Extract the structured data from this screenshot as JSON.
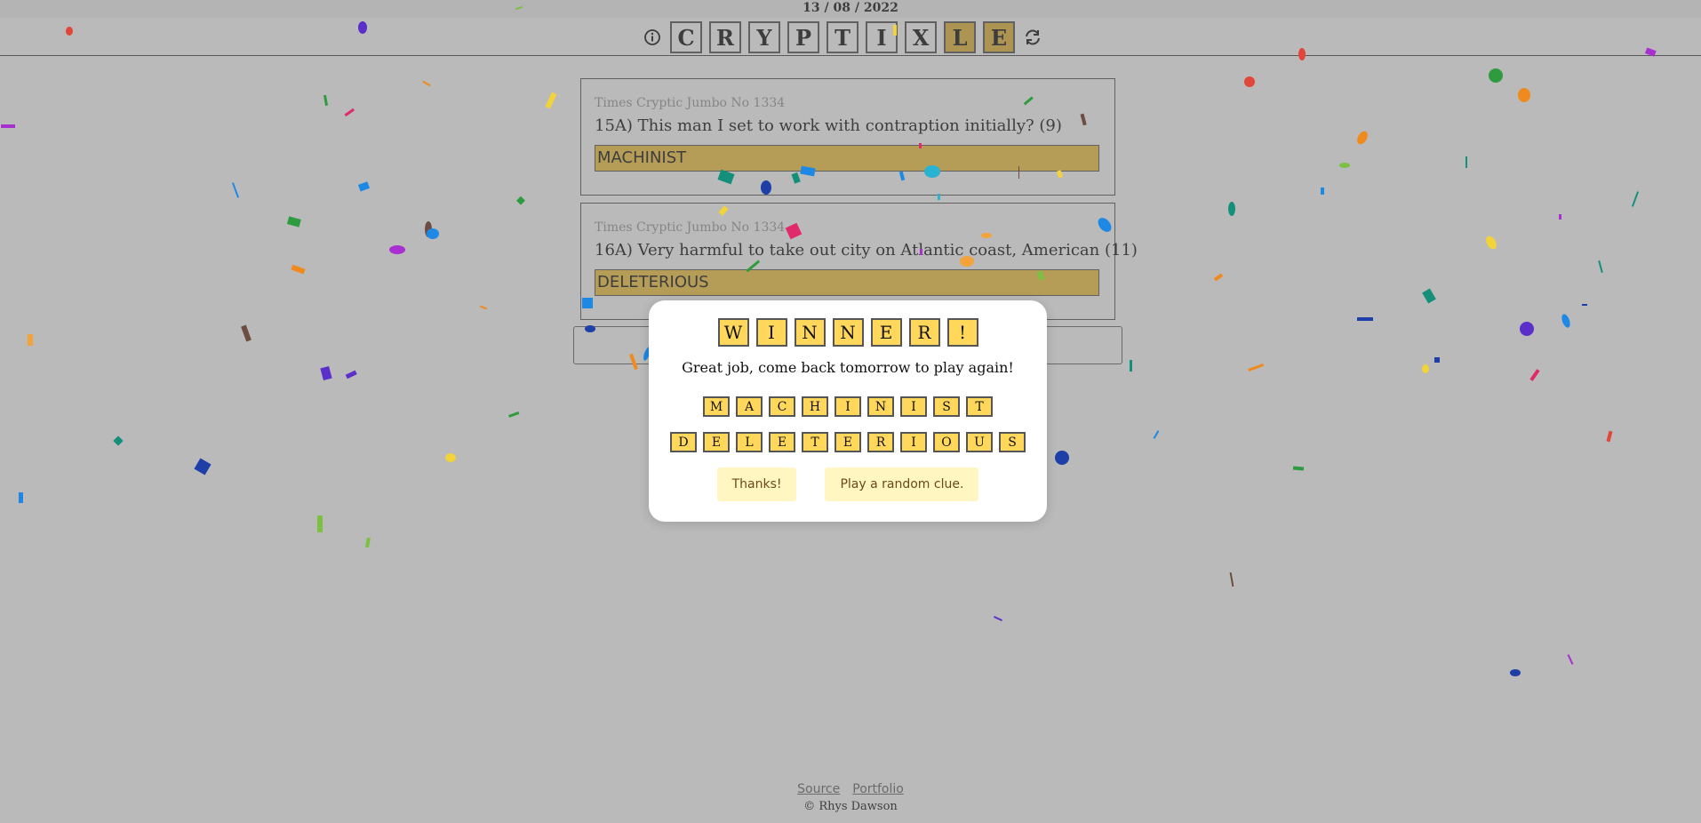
{
  "header": {
    "date": "13 / 08 / 2022",
    "title_letters": [
      {
        "char": "C",
        "highlight": false
      },
      {
        "char": "R",
        "highlight": false
      },
      {
        "char": "Y",
        "highlight": false
      },
      {
        "char": "P",
        "highlight": false
      },
      {
        "char": "T",
        "highlight": false
      },
      {
        "char": "I",
        "highlight": false
      },
      {
        "char": "X",
        "highlight": false
      },
      {
        "char": "L",
        "highlight": true
      },
      {
        "char": "E",
        "highlight": true
      }
    ],
    "info_icon": "info-circle-icon",
    "refresh_icon": "refresh-icon"
  },
  "clues": [
    {
      "source": "Times Cryptic Jumbo No 1334",
      "text": "15A) This man I set to work with contraption initially? (9)",
      "answer": "MACHINIST"
    },
    {
      "source": "Times Cryptic Jumbo No 1334",
      "text": "16A) Very harmful to take out city on Atlantic coast, American (11)",
      "answer": "DELETERIOUS"
    }
  ],
  "modal": {
    "winner_letters": [
      "W",
      "I",
      "N",
      "N",
      "E",
      "R",
      "!"
    ],
    "message": "Great job, come back tomorrow to play again!",
    "answer_rows": [
      [
        "M",
        "A",
        "C",
        "H",
        "I",
        "N",
        "I",
        "S",
        "T"
      ],
      [
        "D",
        "E",
        "L",
        "E",
        "T",
        "E",
        "R",
        "I",
        "O",
        "U",
        "S"
      ]
    ],
    "thanks_label": "Thanks!",
    "random_label": "Play a random clue."
  },
  "footer": {
    "source_label": "Source",
    "portfolio_label": "Portfolio",
    "copyright": "© Rhys Dawson"
  },
  "colors": {
    "tile_gold": "#e6b73a",
    "answer_gold": "#f5c842",
    "modal_tile": "#ffd75a",
    "button_bg": "#fff6c2",
    "overlay": "rgba(110,110,110,0.48)"
  }
}
